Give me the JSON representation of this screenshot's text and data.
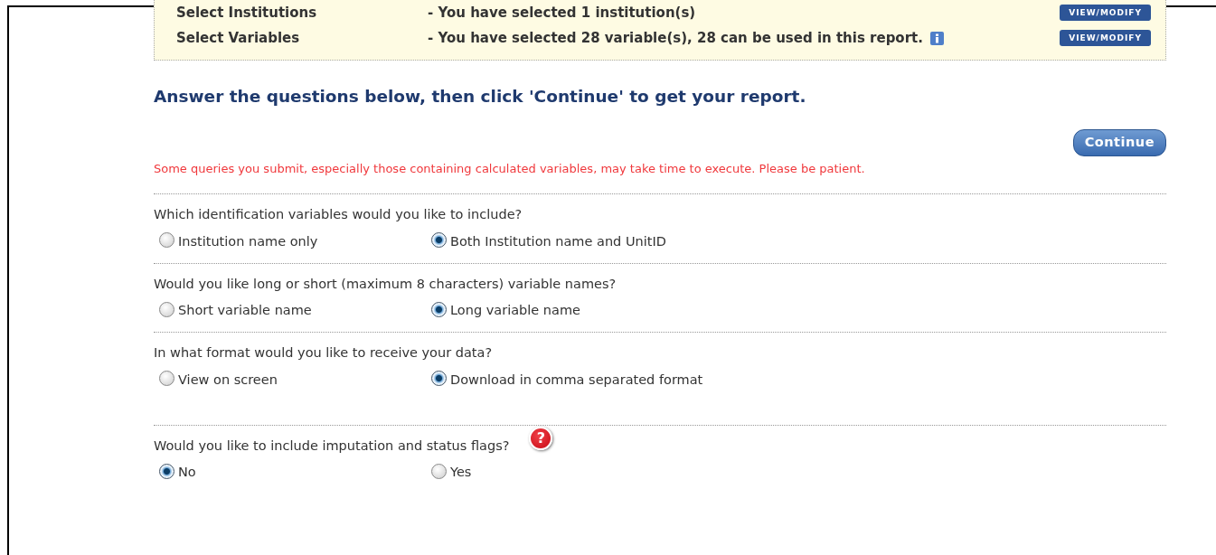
{
  "summary": [
    {
      "label": "Select Institutions",
      "text": "- You have selected 1 institution(s)",
      "info": false,
      "button": "VIEW/MODIFY"
    },
    {
      "label": "Select Variables",
      "text": "- You have selected 28 variable(s), 28 can be used in this report.",
      "info": true,
      "button": "VIEW/MODIFY"
    }
  ],
  "heading": "Answer the questions below, then click 'Continue' to get your report.",
  "continue_button": "Continue",
  "notice": "Some queries you submit, especially those containing calculated variables, may take time to execute. Please be patient.",
  "questions": [
    {
      "text": "Which identification variables would you like to include?",
      "options": [
        {
          "label": "Institution name only",
          "selected": false
        },
        {
          "label": "Both Institution name and UnitID",
          "selected": true
        }
      ]
    },
    {
      "text": "Would you like long or short (maximum 8 characters) variable names?",
      "options": [
        {
          "label": "Short variable name",
          "selected": false
        },
        {
          "label": "Long variable name",
          "selected": true
        }
      ]
    },
    {
      "text": "In what format would you like to receive your data?",
      "options": [
        {
          "label": "View on screen",
          "selected": false
        },
        {
          "label": "Download in comma separated format",
          "selected": true
        }
      ]
    },
    {
      "text": "Would you like to include imputation and status flags?",
      "help_icon": "?",
      "options": [
        {
          "label": "No",
          "selected": true
        },
        {
          "label": "Yes",
          "selected": false
        }
      ]
    }
  ]
}
